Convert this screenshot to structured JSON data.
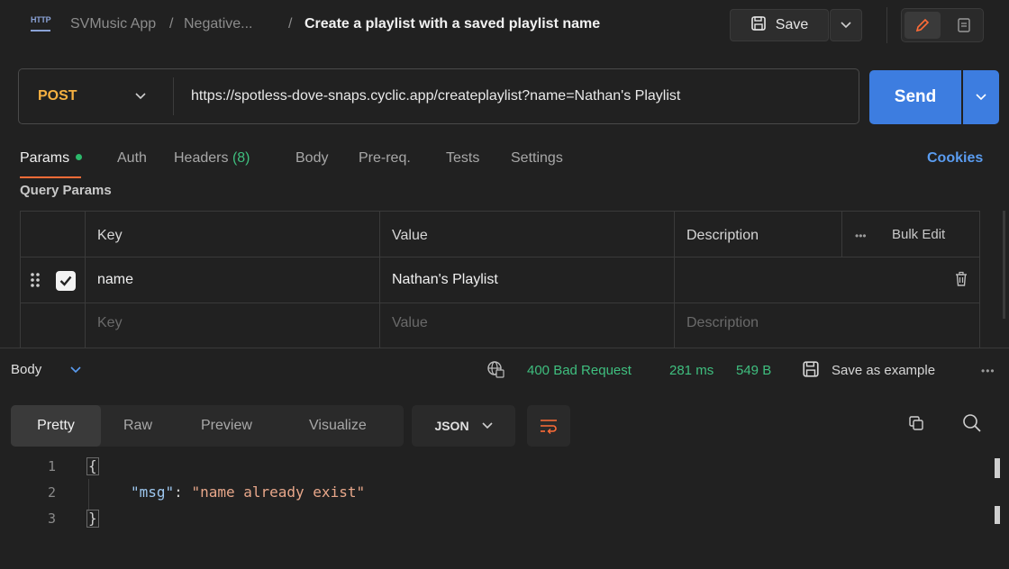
{
  "breadcrumb": {
    "icon": "http-icon",
    "icon_text": "HTTP",
    "workspace": "SVMusic App",
    "separator1": "/",
    "folder": "Negative...",
    "separator2": "/",
    "request_name": "Create a playlist with a saved playlist name"
  },
  "toolbar": {
    "save_label": "Save"
  },
  "request": {
    "method": "POST",
    "url": "https://spotless-dove-snaps.cyclic.app/createplaylist?name=Nathan's Playlist",
    "send_label": "Send"
  },
  "tabs": [
    {
      "label": "Params",
      "active": true,
      "indicator": "green-dot"
    },
    {
      "label": "Auth"
    },
    {
      "label": "Headers",
      "count": "(8)"
    },
    {
      "label": "Body"
    },
    {
      "label": "Pre-req."
    },
    {
      "label": "Tests"
    },
    {
      "label": "Settings"
    }
  ],
  "cookies_label": "Cookies",
  "query_params": {
    "title": "Query Params",
    "columns": {
      "key": "Key",
      "value": "Value",
      "description": "Description"
    },
    "bulk_edit": "Bulk Edit",
    "more": "•••",
    "rows": [
      {
        "checked": true,
        "key": "name",
        "value": "Nathan's Playlist",
        "description": ""
      }
    ],
    "placeholders": {
      "key": "Key",
      "value": "Value",
      "description": "Description"
    }
  },
  "response": {
    "section_label": "Body",
    "status": "400 Bad Request",
    "time": "281 ms",
    "size": "549 B",
    "save_example": "Save as example",
    "more": "•••",
    "view_tabs": [
      "Pretty",
      "Raw",
      "Preview",
      "Visualize"
    ],
    "active_view": "Pretty",
    "format": "JSON",
    "code_lines": [
      {
        "num": "1",
        "text": "{"
      },
      {
        "num": "2",
        "key": "\"msg\"",
        "colon": ": ",
        "value": "\"name already exist\""
      },
      {
        "num": "3",
        "text": "}"
      }
    ]
  },
  "colors": {
    "accent": "#ff6c37",
    "send": "#3d7de0",
    "method_post": "#f5b041",
    "status_error": "#3fbf7f",
    "json_key": "#9ec8f0",
    "json_string": "#e8a78a"
  }
}
